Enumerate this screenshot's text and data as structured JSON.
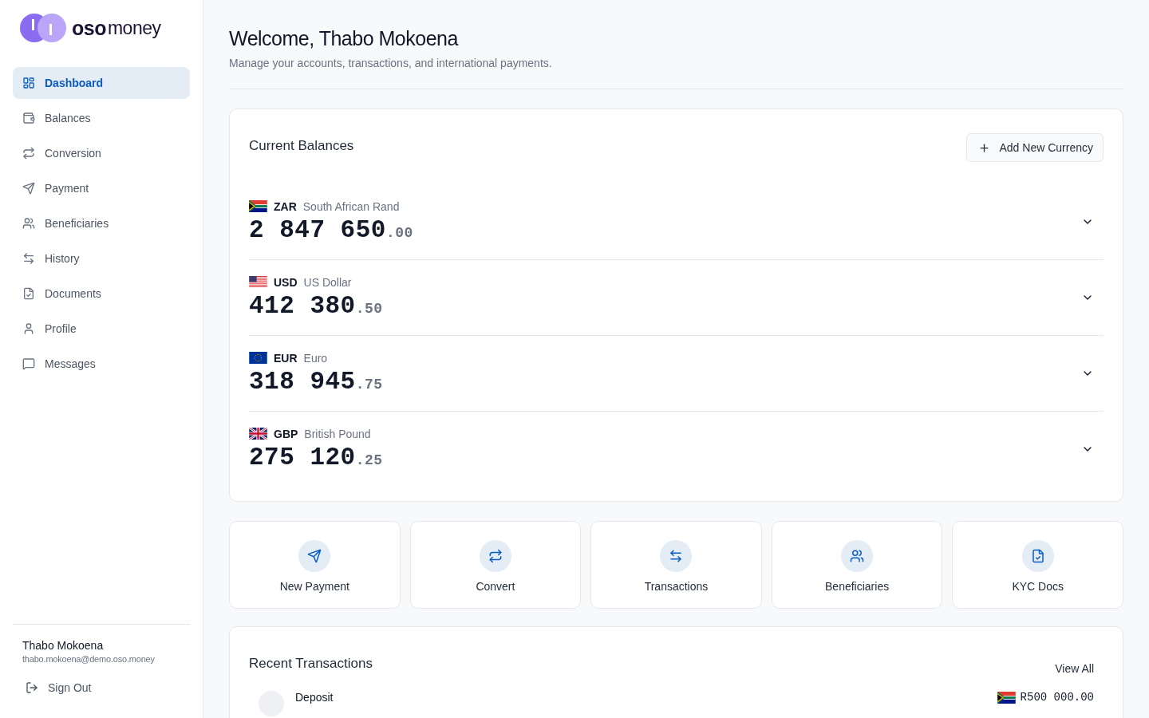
{
  "logo": {
    "brand": "oso",
    "suffix": "money"
  },
  "sidebar": {
    "items": [
      {
        "label": "Dashboard",
        "selected": true
      },
      {
        "label": "Balances",
        "selected": false
      },
      {
        "label": "Conversion",
        "selected": false
      },
      {
        "label": "Payment",
        "selected": false
      },
      {
        "label": "Beneficiaries",
        "selected": false
      },
      {
        "label": "History",
        "selected": false
      },
      {
        "label": "Documents",
        "selected": false
      },
      {
        "label": "Profile",
        "selected": false
      },
      {
        "label": "Messages",
        "selected": false
      }
    ],
    "user": {
      "name": "Thabo Mokoena",
      "email": "thabo.mokoena@demo.oso.money"
    },
    "sign_out": "Sign Out"
  },
  "header": {
    "title": "Welcome, Thabo Mokoena",
    "subtitle": "Manage your accounts, transactions, and international payments."
  },
  "balances": {
    "title": "Current Balances",
    "add_button": "Add New Currency",
    "items": [
      {
        "kind": "za",
        "code": "ZAR",
        "name": "South African Rand",
        "whole": "2 847 650",
        "decimals": ".00"
      },
      {
        "kind": "us",
        "code": "USD",
        "name": "US Dollar",
        "whole": "412 380",
        "decimals": ".50"
      },
      {
        "kind": "eu",
        "code": "EUR",
        "name": "Euro",
        "whole": "318 945",
        "decimals": ".75"
      },
      {
        "kind": "gb",
        "code": "GBP",
        "name": "British Pound",
        "whole": "275 120",
        "decimals": ".25"
      }
    ]
  },
  "quick_actions": [
    {
      "label": "New Payment"
    },
    {
      "label": "Convert"
    },
    {
      "label": "Transactions"
    },
    {
      "label": "Beneficiaries"
    },
    {
      "label": "KYC Docs"
    }
  ],
  "recent_transactions": {
    "title": "Recent Transactions",
    "view_all": "View All",
    "rows": [
      {
        "title": "Deposit",
        "kind": "za",
        "amount": "R500 000.00"
      }
    ]
  }
}
